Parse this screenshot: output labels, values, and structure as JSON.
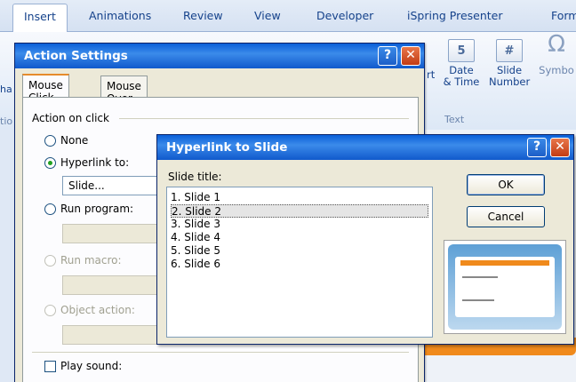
{
  "ribbon": {
    "tabs": [
      "Insert",
      "Animations",
      "Review",
      "View",
      "Developer",
      "iSpring Presenter",
      "Form"
    ],
    "buttons": {
      "date_time_l1": "Date",
      "date_time_l2": "& Time",
      "slide_number_l1": "Slide",
      "slide_number_l2": "Number",
      "symbol": "Symbo",
      "art": "rt"
    },
    "group_text": "Text",
    "left_fragments": [
      "ha",
      "tio"
    ]
  },
  "action_settings": {
    "title": "Action Settings",
    "tabs": [
      "Mouse Click",
      "Mouse Over"
    ],
    "action_on_click_label": "Action on click",
    "options": {
      "none": "None",
      "hyperlink_to": "Hyperlink to:",
      "hyperlink_value": "Slide...",
      "run_program": "Run program:",
      "run_macro": "Run macro:",
      "object_action": "Object action:"
    },
    "play_sound_label": "Play sound:"
  },
  "hyperlink_dialog": {
    "title": "Hyperlink to Slide",
    "slide_title_label": "Slide title:",
    "slides": [
      "1. Slide 1",
      "2. Slide 2",
      "3. Slide 3",
      "4. Slide 4",
      "5. Slide 5",
      "6. Slide 6"
    ],
    "selected_index": 1,
    "ok_label": "OK",
    "cancel_label": "Cancel"
  },
  "titlebar_buttons": {
    "help": "?",
    "close": "✕"
  },
  "colors": {
    "titlebar": "#0a5fd8",
    "accent_orange": "#f08a1c",
    "dialog_bg": "#ece9d8"
  }
}
